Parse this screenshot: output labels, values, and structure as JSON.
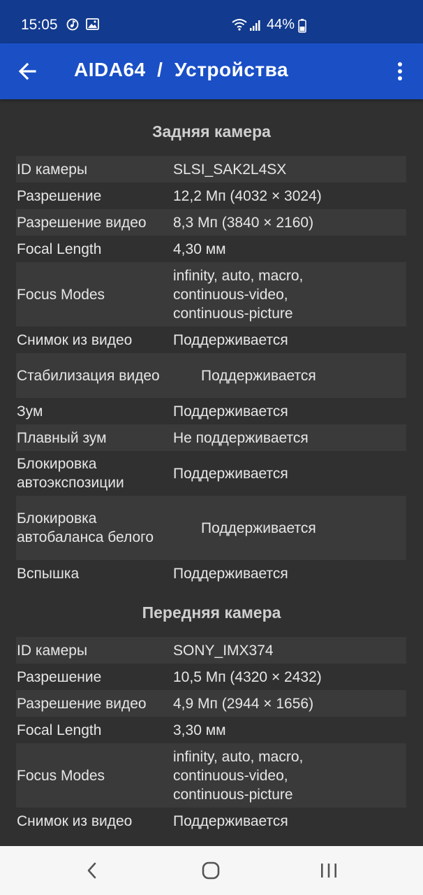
{
  "status_bar": {
    "time": "15:05",
    "battery": "44%",
    "icons": [
      "music-notification-icon",
      "image-notification-icon",
      "wifi-icon",
      "signal-icon",
      "battery-icon"
    ]
  },
  "app_bar": {
    "title": "AIDA64  /  Устройства",
    "back_icon": "arrow-left-icon",
    "menu_icon": "more-vert-icon"
  },
  "colors": {
    "status_bar": "#123a8e",
    "app_bar": "#1a4fc6",
    "background": "#303030",
    "row_shade": "#3a3a3a"
  },
  "rear_camera": {
    "title": "Задняя камера",
    "rows": [
      {
        "label": "ID камеры",
        "value": "SLSI_SAK2L4SX"
      },
      {
        "label": "Разрешение",
        "value": "12,2 Мп (4032 × 3024)"
      },
      {
        "label": "Разрешение видео",
        "value": "8,3 Мп (3840 × 2160)"
      },
      {
        "label": "Focal Length",
        "value": "4,30 мм"
      },
      {
        "label": "Focus Modes",
        "value": "infinity, auto, macro, continuous-video, continuous-picture"
      },
      {
        "label": "Снимок из видео",
        "value": "Поддерживается"
      },
      {
        "label": "Стабилизация видео",
        "value": "Поддерживается"
      },
      {
        "label": "Зум",
        "value": "Поддерживается"
      },
      {
        "label": "Плавный зум",
        "value": "Не поддерживается"
      },
      {
        "label": "Блокировка автоэкспозиции",
        "value": "Поддерживается"
      },
      {
        "label": "Блокировка автобаланса белого",
        "value": "Поддерживается"
      },
      {
        "label": "Вспышка",
        "value": "Поддерживается"
      }
    ]
  },
  "front_camera": {
    "title": "Передняя камера",
    "rows": [
      {
        "label": "ID камеры",
        "value": "SONY_IMX374"
      },
      {
        "label": "Разрешение",
        "value": "10,5 Мп (4320 × 2432)"
      },
      {
        "label": "Разрешение видео",
        "value": "4,9 Мп (2944 × 1656)"
      },
      {
        "label": "Focal Length",
        "value": "3,30 мм"
      },
      {
        "label": "Focus Modes",
        "value": "infinity, auto, macro, continuous-video, continuous-picture"
      },
      {
        "label": "Снимок из видео",
        "value": "Поддерживается"
      }
    ]
  },
  "nav_bar": {
    "icons": [
      "nav-back-icon",
      "nav-home-icon",
      "nav-recents-icon"
    ]
  }
}
